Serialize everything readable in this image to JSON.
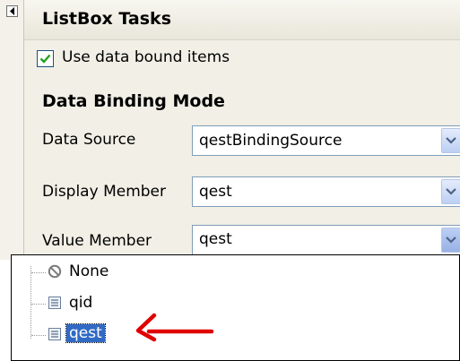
{
  "panel": {
    "title": "ListBox Tasks",
    "checkbox": {
      "label": "Use data bound items",
      "checked": true
    },
    "section_title": "Data Binding Mode",
    "properties": [
      {
        "label": "Data Source",
        "value": "qestBindingSource"
      },
      {
        "label": "Display Member",
        "value": "qest"
      },
      {
        "label": "Value Member",
        "value": "qest"
      }
    ]
  },
  "dropdown": {
    "items": [
      {
        "label": "None",
        "icon": "none-icon"
      },
      {
        "label": "qid",
        "icon": "field-icon"
      },
      {
        "label": "qest",
        "icon": "field-icon",
        "selected": true
      }
    ]
  },
  "colors": {
    "selection": "#316ac5",
    "annotation_arrow": "#e00000",
    "checkmark": "#21a121"
  }
}
